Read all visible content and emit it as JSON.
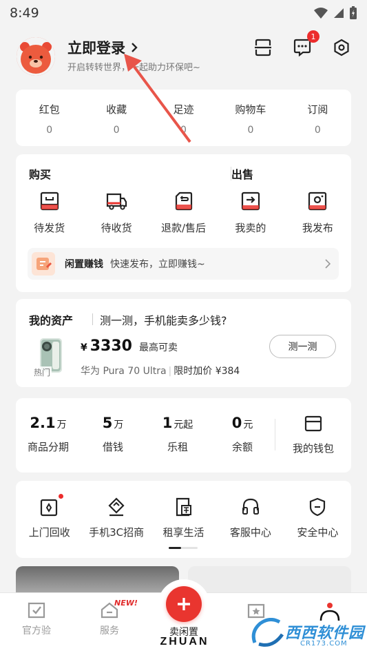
{
  "status_bar": {
    "time": "8:49"
  },
  "header": {
    "login_title": "立即登录",
    "login_subtitle": "开启转转世界，一起助力环保吧~",
    "message_badge": "1",
    "icons": [
      "scan-icon",
      "message-icon",
      "settings-icon"
    ]
  },
  "stats": [
    {
      "label": "红包",
      "value": "0"
    },
    {
      "label": "收藏",
      "value": "0"
    },
    {
      "label": "足迹",
      "value": "0"
    },
    {
      "label": "购物车",
      "value": "0"
    },
    {
      "label": "订阅",
      "value": "0"
    }
  ],
  "orders": {
    "buy_title": "购买",
    "sell_title": "出售",
    "items": [
      {
        "label": "待发货",
        "icon": "pending-ship-icon"
      },
      {
        "label": "待收货",
        "icon": "truck-icon"
      },
      {
        "label": "退款/售后",
        "icon": "refund-icon"
      },
      {
        "label": "我卖的",
        "icon": "sold-icon"
      },
      {
        "label": "我发布",
        "icon": "camera-icon"
      }
    ],
    "promo": {
      "title": "闲置赚钱",
      "desc": "快速发布，立即赚钱~"
    }
  },
  "assets": {
    "title": "我的资产",
    "question": "测一测，手机能卖多少钱?",
    "hot_tag": "热门",
    "currency": "¥",
    "price": "3330",
    "price_note": "最高可卖",
    "model": "华为 Pura 70 Ultra",
    "bump": "限时加价 ¥384",
    "button": "测一测"
  },
  "finance": [
    {
      "number": "2.1",
      "unit": "万",
      "label": "商品分期"
    },
    {
      "number": "5",
      "unit": "万",
      "label": "借钱"
    },
    {
      "number": "1",
      "unit": "元起",
      "label": "乐租"
    },
    {
      "number": "0",
      "unit": "元",
      "label": "余额"
    }
  ],
  "wallet": {
    "label": "我的钱包"
  },
  "services": [
    {
      "label": "上门回收",
      "icon": "recycle-box-icon"
    },
    {
      "label": "手机3C招商",
      "icon": "diamond-tag-icon"
    },
    {
      "label": "租享生活",
      "icon": "rent-icon"
    },
    {
      "label": "客服中心",
      "icon": "headset-icon"
    },
    {
      "label": "安全中心",
      "icon": "shield-icon"
    }
  ],
  "tabbar": {
    "tabs": [
      {
        "label": "官方验",
        "icon": "verify-icon"
      },
      {
        "label": "服务",
        "icon": "service-home-icon"
      },
      {
        "label": "卖闲置",
        "icon": "plus-icon"
      },
      {
        "label": "",
        "icon": "star-box-icon"
      },
      {
        "label": "",
        "icon": "profile-icon"
      }
    ],
    "new_tag": "NEW!",
    "brand": "ZHUAN"
  },
  "watermark": {
    "text": "西西软件园",
    "url_text": "CR173.COM"
  },
  "colors": {
    "accent": "#e9352f",
    "background": "#f3f3f3",
    "card": "#ffffff"
  }
}
